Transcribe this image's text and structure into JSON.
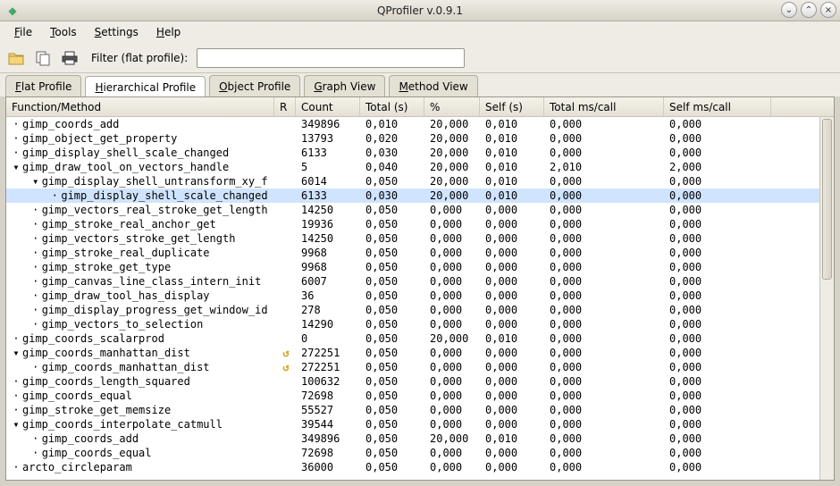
{
  "window": {
    "title": "QProfiler v.0.9.1",
    "min_glyph": "⌄",
    "max_glyph": "⌃",
    "close_glyph": "×"
  },
  "menu": {
    "items": [
      {
        "label": "File",
        "u": "F"
      },
      {
        "label": "Tools",
        "u": "T"
      },
      {
        "label": "Settings",
        "u": "S"
      },
      {
        "label": "Help",
        "u": "H"
      }
    ]
  },
  "toolbar": {
    "filter_label": "Filter (flat profile):",
    "filter_value": "",
    "filter_placeholder": ""
  },
  "tabs": {
    "items": [
      {
        "id": "flat",
        "label": "Flat Profile",
        "u": "F",
        "active": false
      },
      {
        "id": "hier",
        "label": "Hierarchical Profile",
        "u": "H",
        "active": true
      },
      {
        "id": "obj",
        "label": "Object Profile",
        "u": "O",
        "active": false
      },
      {
        "id": "graph",
        "label": "Graph View",
        "u": "G",
        "active": false
      },
      {
        "id": "meth",
        "label": "Method View",
        "u": "M",
        "active": false
      }
    ]
  },
  "columns": {
    "fn": "Function/Method",
    "r": "R",
    "count": "Count",
    "total": "Total (s)",
    "pct": "%",
    "self": "Self (s)",
    "tmc": "Total ms/call",
    "smc": "Self ms/call"
  },
  "rows": [
    {
      "depth": 1,
      "exp": "",
      "fn": "gimp_coords_add",
      "r": "",
      "ct": "349896",
      "tot": "0,010",
      "pct": "20,000",
      "self": "0,010",
      "tmc": "0,000",
      "smc": "0,000"
    },
    {
      "depth": 1,
      "exp": "",
      "fn": "gimp_object_get_property",
      "r": "",
      "ct": "13793",
      "tot": "0,020",
      "pct": "20,000",
      "self": "0,010",
      "tmc": "0,000",
      "smc": "0,000"
    },
    {
      "depth": 1,
      "exp": "",
      "fn": "gimp_display_shell_scale_changed",
      "r": "",
      "ct": "6133",
      "tot": "0,030",
      "pct": "20,000",
      "self": "0,010",
      "tmc": "0,000",
      "smc": "0,000"
    },
    {
      "depth": 1,
      "exp": "v",
      "fn": "gimp_draw_tool_on_vectors_handle",
      "r": "",
      "ct": "5",
      "tot": "0,040",
      "pct": "20,000",
      "self": "0,010",
      "tmc": "2,010",
      "smc": "2,000"
    },
    {
      "depth": 2,
      "exp": "v",
      "fn": "gimp_display_shell_untransform_xy_f",
      "r": "",
      "ct": "6014",
      "tot": "0,050",
      "pct": "20,000",
      "self": "0,010",
      "tmc": "0,000",
      "smc": "0,000"
    },
    {
      "depth": 3,
      "exp": "",
      "fn": "gimp_display_shell_scale_changed",
      "r": "",
      "ct": "6133",
      "tot": "0,030",
      "pct": "20,000",
      "self": "0,010",
      "tmc": "0,000",
      "smc": "0,000",
      "selected": true
    },
    {
      "depth": 2,
      "exp": "",
      "fn": "gimp_vectors_real_stroke_get_length",
      "r": "",
      "ct": "14250",
      "tot": "0,050",
      "pct": "0,000",
      "self": "0,000",
      "tmc": "0,000",
      "smc": "0,000"
    },
    {
      "depth": 2,
      "exp": "",
      "fn": "gimp_stroke_real_anchor_get",
      "r": "",
      "ct": "19936",
      "tot": "0,050",
      "pct": "0,000",
      "self": "0,000",
      "tmc": "0,000",
      "smc": "0,000"
    },
    {
      "depth": 2,
      "exp": "",
      "fn": "gimp_vectors_stroke_get_length",
      "r": "",
      "ct": "14250",
      "tot": "0,050",
      "pct": "0,000",
      "self": "0,000",
      "tmc": "0,000",
      "smc": "0,000"
    },
    {
      "depth": 2,
      "exp": "",
      "fn": "gimp_stroke_real_duplicate",
      "r": "",
      "ct": "9968",
      "tot": "0,050",
      "pct": "0,000",
      "self": "0,000",
      "tmc": "0,000",
      "smc": "0,000"
    },
    {
      "depth": 2,
      "exp": "",
      "fn": "gimp_stroke_get_type",
      "r": "",
      "ct": "9968",
      "tot": "0,050",
      "pct": "0,000",
      "self": "0,000",
      "tmc": "0,000",
      "smc": "0,000"
    },
    {
      "depth": 2,
      "exp": "",
      "fn": "gimp_canvas_line_class_intern_init",
      "r": "",
      "ct": "6007",
      "tot": "0,050",
      "pct": "0,000",
      "self": "0,000",
      "tmc": "0,000",
      "smc": "0,000"
    },
    {
      "depth": 2,
      "exp": "",
      "fn": "gimp_draw_tool_has_display",
      "r": "",
      "ct": "36",
      "tot": "0,050",
      "pct": "0,000",
      "self": "0,000",
      "tmc": "0,000",
      "smc": "0,000"
    },
    {
      "depth": 2,
      "exp": "",
      "fn": "gimp_display_progress_get_window_id",
      "r": "",
      "ct": "278",
      "tot": "0,050",
      "pct": "0,000",
      "self": "0,000",
      "tmc": "0,000",
      "smc": "0,000"
    },
    {
      "depth": 2,
      "exp": "",
      "fn": "gimp_vectors_to_selection",
      "r": "",
      "ct": "14290",
      "tot": "0,050",
      "pct": "0,000",
      "self": "0,000",
      "tmc": "0,000",
      "smc": "0,000"
    },
    {
      "depth": 1,
      "exp": "",
      "fn": "gimp_coords_scalarprod",
      "r": "",
      "ct": "0",
      "tot": "0,050",
      "pct": "20,000",
      "self": "0,010",
      "tmc": "0,000",
      "smc": "0,000"
    },
    {
      "depth": 1,
      "exp": "v",
      "fn": "gimp_coords_manhattan_dist",
      "r": "rec",
      "ct": "272251",
      "tot": "0,050",
      "pct": "0,000",
      "self": "0,000",
      "tmc": "0,000",
      "smc": "0,000"
    },
    {
      "depth": 2,
      "exp": "",
      "fn": "gimp_coords_manhattan_dist",
      "r": "rec",
      "ct": "272251",
      "tot": "0,050",
      "pct": "0,000",
      "self": "0,000",
      "tmc": "0,000",
      "smc": "0,000"
    },
    {
      "depth": 1,
      "exp": "",
      "fn": "gimp_coords_length_squared",
      "r": "",
      "ct": "100632",
      "tot": "0,050",
      "pct": "0,000",
      "self": "0,000",
      "tmc": "0,000",
      "smc": "0,000"
    },
    {
      "depth": 1,
      "exp": "",
      "fn": "gimp_coords_equal",
      "r": "",
      "ct": "72698",
      "tot": "0,050",
      "pct": "0,000",
      "self": "0,000",
      "tmc": "0,000",
      "smc": "0,000"
    },
    {
      "depth": 1,
      "exp": "",
      "fn": "gimp_stroke_get_memsize",
      "r": "",
      "ct": "55527",
      "tot": "0,050",
      "pct": "0,000",
      "self": "0,000",
      "tmc": "0,000",
      "smc": "0,000"
    },
    {
      "depth": 1,
      "exp": "v",
      "fn": "gimp_coords_interpolate_catmull",
      "r": "",
      "ct": "39544",
      "tot": "0,050",
      "pct": "0,000",
      "self": "0,000",
      "tmc": "0,000",
      "smc": "0,000"
    },
    {
      "depth": 2,
      "exp": "",
      "fn": "gimp_coords_add",
      "r": "",
      "ct": "349896",
      "tot": "0,050",
      "pct": "20,000",
      "self": "0,010",
      "tmc": "0,000",
      "smc": "0,000"
    },
    {
      "depth": 2,
      "exp": "",
      "fn": "gimp_coords_equal",
      "r": "",
      "ct": "72698",
      "tot": "0,050",
      "pct": "0,000",
      "self": "0,000",
      "tmc": "0,000",
      "smc": "0,000"
    },
    {
      "depth": 1,
      "exp": "",
      "fn": "arcto_circleparam",
      "r": "",
      "ct": "36000",
      "tot": "0,050",
      "pct": "0,000",
      "self": "0,000",
      "tmc": "0,000",
      "smc": "0,000"
    }
  ]
}
